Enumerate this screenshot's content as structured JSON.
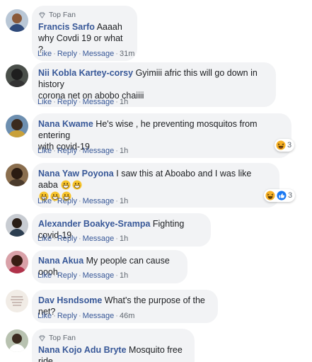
{
  "actions": {
    "like": "Like",
    "reply": "Reply",
    "message": "Message",
    "separator": "·"
  },
  "badge_label": "Top Fan",
  "comments": [
    {
      "name": "Francis Sarfo",
      "text": "Aaaah why Covdi 19 or what ?",
      "line2": "",
      "time": "31m",
      "top_fan": true,
      "reaction_count": ""
    },
    {
      "name": "Nii Kobla Kartey-corsy",
      "text": "Gyimiii afric this will go down in history",
      "line2": "corona net on abobo chaiiii",
      "time": "1h",
      "top_fan": false,
      "reaction_count": ""
    },
    {
      "name": "Nana Kwame",
      "text": "He's wise , he preventing mosquitos from entering",
      "line2": "with covid-19",
      "time": "1h",
      "top_fan": false,
      "reaction_count": "3"
    },
    {
      "name": "Nana Yaw Poyona",
      "text": "I saw this at Aboabo and I was like aaba",
      "line2": "",
      "time": "1h",
      "top_fan": false,
      "reaction_count": "3"
    },
    {
      "name": "Alexander Boakye-Srampa",
      "text": "Fighting covid-19",
      "line2": "",
      "time": "1h",
      "top_fan": false,
      "reaction_count": ""
    },
    {
      "name": "Nana Akua",
      "text": "My people can cause oooh",
      "line2": "",
      "time": "1h",
      "top_fan": false,
      "reaction_count": ""
    },
    {
      "name": "Dav Hsndsome",
      "text": "What's the purpose of the net?",
      "line2": "",
      "time": "46m",
      "top_fan": false,
      "reaction_count": ""
    },
    {
      "name": "Nana Kojo Adu Bryte",
      "text": "Mosquito free ride",
      "line2": "",
      "time": "",
      "top_fan": true,
      "reaction_count": ""
    }
  ],
  "icons": {
    "badge": "diamond-icon",
    "reaction_haha": "haha-icon",
    "reaction_like": "like-icon",
    "emoji": "grinning-face-icon"
  },
  "colors": {
    "name": "#385898",
    "bubble": "#f2f3f5",
    "meta": "#606770"
  }
}
